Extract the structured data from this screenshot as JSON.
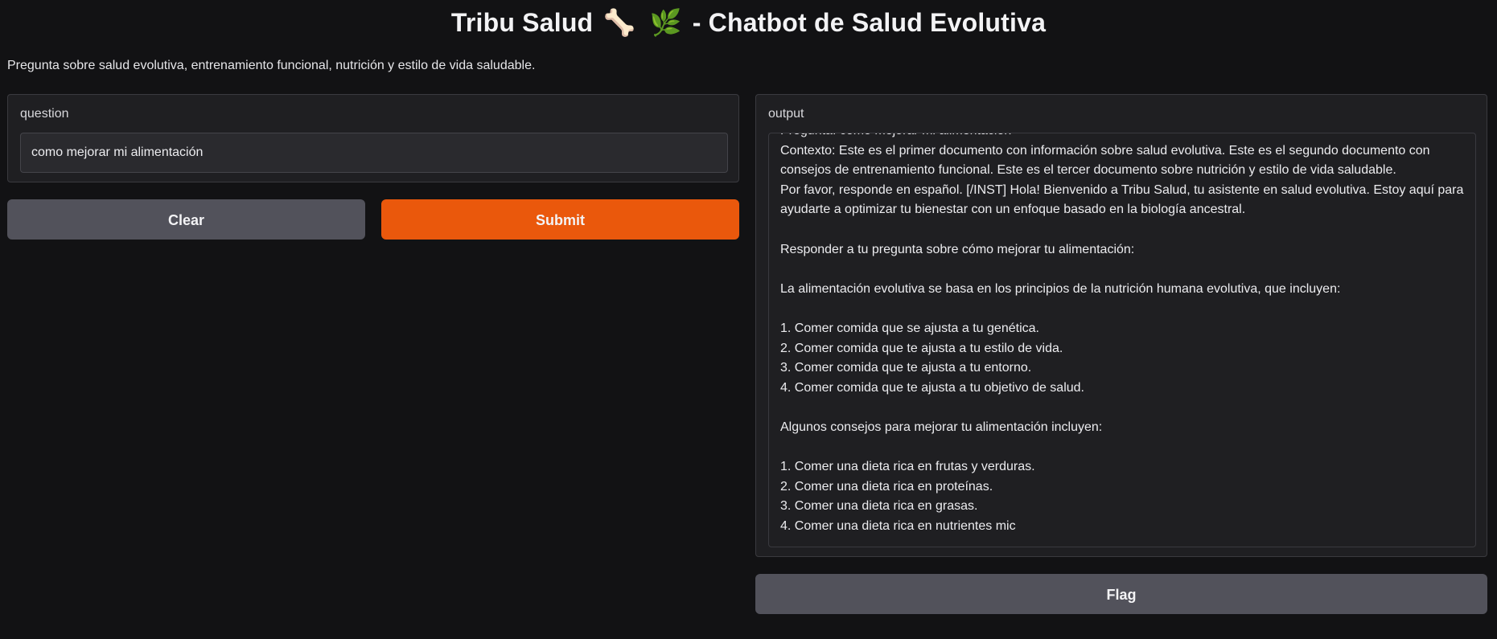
{
  "header": {
    "title_prefix": "Tribu Salud",
    "emoji_bone": "🦴",
    "emoji_herb": "🌿",
    "title_suffix": "- Chatbot de Salud Evolutiva",
    "description": "Pregunta sobre salud evolutiva, entrenamiento funcional, nutrición y estilo de vida saludable."
  },
  "input_panel": {
    "label": "question",
    "value": "como mejorar mi alimentación"
  },
  "buttons": {
    "clear": "Clear",
    "submit": "Submit",
    "flag": "Flag"
  },
  "output_panel": {
    "label": "output",
    "text": "Pregunta: como mejorar mi alimentación\nContexto: Este es el primer documento con información sobre salud evolutiva. Este es el segundo documento con consejos de entrenamiento funcional. Este es el tercer documento sobre nutrición y estilo de vida saludable.\nPor favor, responde en español. [/INST] Hola! Bienvenido a Tribu Salud, tu asistente en salud evolutiva. Estoy aquí para ayudarte a optimizar tu bienestar con un enfoque basado en la biología ancestral.\n\nResponder a tu pregunta sobre cómo mejorar tu alimentación:\n\nLa alimentación evolutiva se basa en los principios de la nutrición humana evolutiva, que incluyen:\n\n1. Comer comida que se ajusta a tu genética.\n2. Comer comida que te ajusta a tu estilo de vida.\n3. Comer comida que te ajusta a tu entorno.\n4. Comer comida que te ajusta a tu objetivo de salud.\n\nAlgunos consejos para mejorar tu alimentación incluyen:\n\n1. Comer una dieta rica en frutas y verduras.\n2. Comer una dieta rica en proteínas.\n3. Comer una dieta rica en grasas.\n4. Comer una dieta rica en nutrientes mic"
  },
  "colors": {
    "background": "#121214",
    "panel": "#1f1f22",
    "primary_button": "#ea580c",
    "secondary_button": "#52525b"
  }
}
